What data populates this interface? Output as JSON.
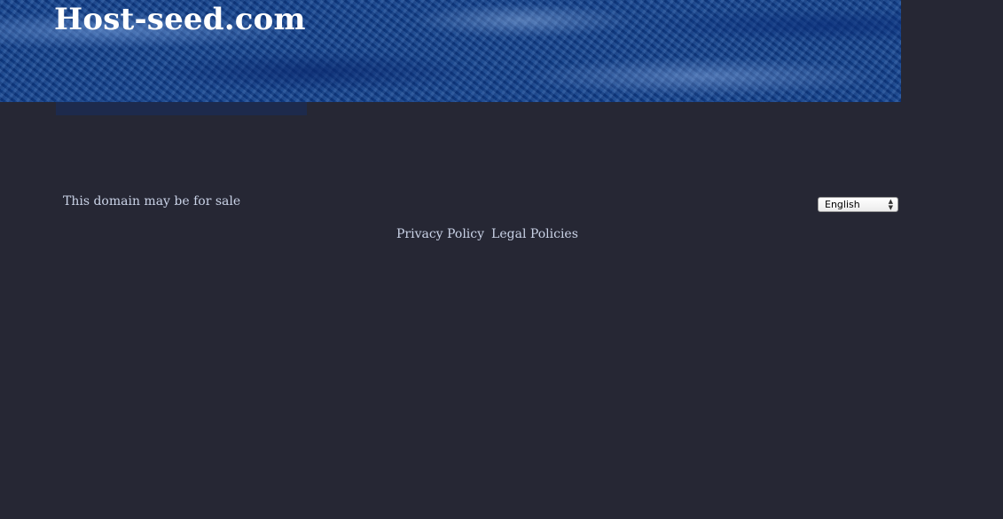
{
  "header": {
    "site_title": "Host-seed.com"
  },
  "content": {
    "sale_notice": "This domain may be for sale"
  },
  "language_selector": {
    "selected": "English",
    "arrow_up": "▲",
    "arrow_down": "▼"
  },
  "footer": {
    "links": [
      {
        "label": "Privacy Policy"
      },
      {
        "label": "Legal Policies"
      }
    ]
  },
  "colors": {
    "page_background": "#262734",
    "banner_blue": "#12418a",
    "text_light": "#c9d2e6",
    "title_white": "#ffffff"
  }
}
